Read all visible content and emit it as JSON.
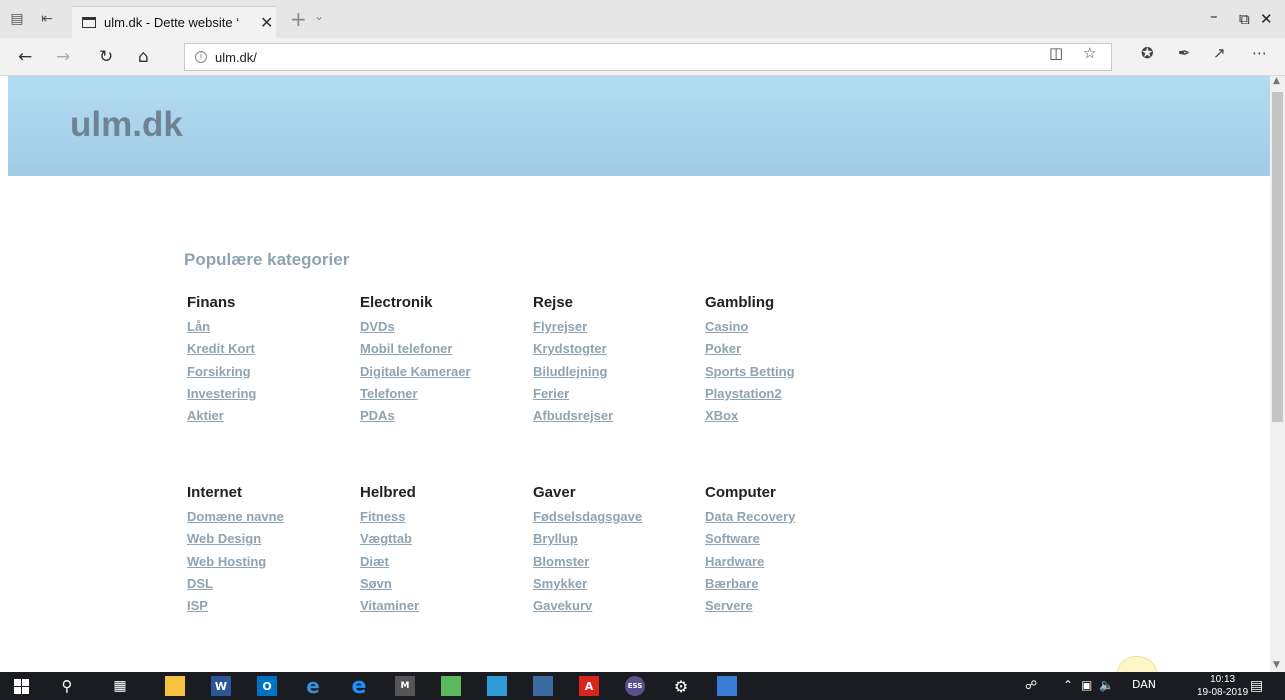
{
  "browser": {
    "tab_title": "ulm.dk - Dette website ‘",
    "url": "ulm.dk/"
  },
  "page": {
    "site_title": "ulm.dk",
    "section_title": "Populære kategorier",
    "categories": [
      {
        "title": "Finans",
        "links": [
          "Lån",
          "Kredit Kort",
          "Forsikring",
          "Investering",
          "Aktier"
        ]
      },
      {
        "title": "Electronik",
        "links": [
          "DVDs",
          "Mobil telefoner",
          "Digitale Kameraer",
          "Telefoner",
          "PDAs"
        ]
      },
      {
        "title": "Rejse",
        "links": [
          "Flyrejser",
          "Krydstogter",
          "Biludlejning",
          "Ferier",
          "Afbudsrejser"
        ]
      },
      {
        "title": "Gambling",
        "links": [
          "Casino",
          "Poker",
          "Sports Betting",
          "Playstation2",
          "XBox"
        ]
      },
      {
        "title": "Internet",
        "links": [
          "Domæne navne",
          "Web Design",
          "Web Hosting",
          "DSL",
          "ISP"
        ]
      },
      {
        "title": "Helbred",
        "links": [
          "Fitness",
          "Vægttab",
          "Diæt",
          "Søvn",
          "Vitaminer"
        ]
      },
      {
        "title": "Gaver",
        "links": [
          "Fødselsdagsgave",
          "Bryllup",
          "Blomster",
          "Smykker",
          "Gavekurv"
        ]
      },
      {
        "title": "Computer",
        "links": [
          "Data Recovery",
          "Software",
          "Hardware",
          "Bærbare",
          "Servere"
        ]
      }
    ]
  },
  "taskbar": {
    "language": "DAN",
    "time": "10:13",
    "date": "19-08-2019"
  }
}
